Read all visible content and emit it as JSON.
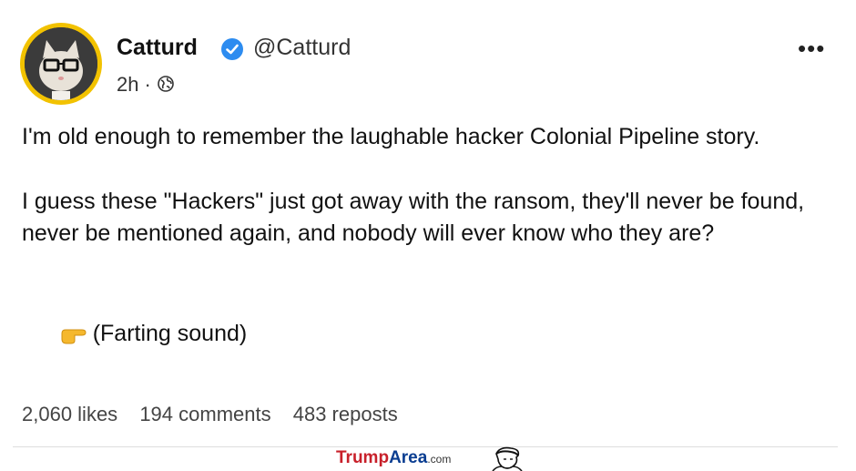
{
  "post": {
    "author_name": "Catturd",
    "handle": "@Catturd",
    "time": "2h",
    "meta_separator": "·",
    "paragraphs": [
      "I'm old enough to remember the laughable hacker Colonial Pipeline story.",
      "I guess these \"Hackers\" just got away with the ransom, they'll never be found, never be mentioned again, and nobody will ever know who they are?"
    ],
    "last_line": "(Farting sound)",
    "stats": {
      "likes": "2,060 likes",
      "comments": "194 comments",
      "reposts": "483 reposts"
    }
  },
  "icons": {
    "verified": "verified-badge-icon",
    "globe": "globe-icon",
    "more": "more-options-icon",
    "pointing": "pointing-finger-emoji"
  },
  "colors": {
    "verified_blue": "#2d8cf0",
    "avatar_ring": "#f2c200"
  },
  "watermark": {
    "brand_part1": "Trump",
    "brand_part2": "Area",
    "brand_suffix": ".com"
  }
}
